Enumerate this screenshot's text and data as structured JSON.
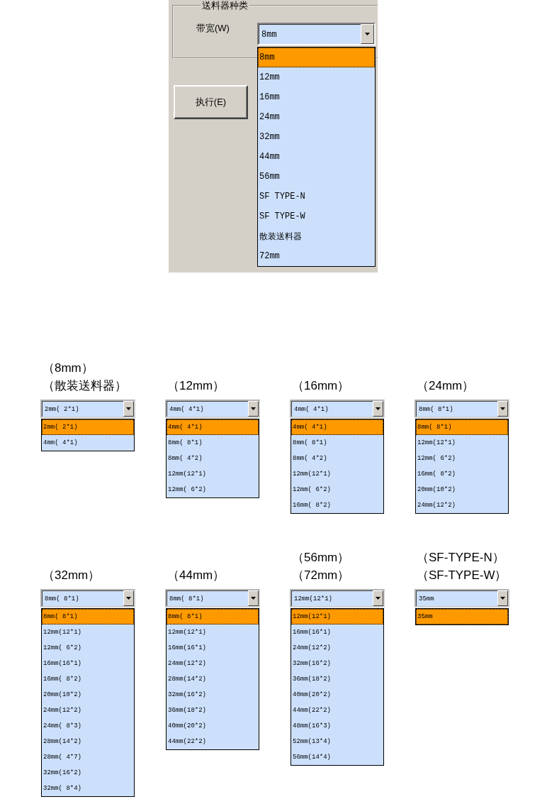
{
  "settings_panel": {
    "group_title": "送料器种类",
    "field_label": "带宽(W)",
    "combo": {
      "value": "8mm",
      "expanded": true,
      "options": [
        {
          "label": "8mm",
          "selected": true
        },
        {
          "label": "12mm",
          "selected": false
        },
        {
          "label": "16mm",
          "selected": false
        },
        {
          "label": "24mm",
          "selected": false
        },
        {
          "label": "32mm",
          "selected": false
        },
        {
          "label": "44mm",
          "selected": false
        },
        {
          "label": "56mm",
          "selected": false
        },
        {
          "label": "SF TYPE-N",
          "selected": false
        },
        {
          "label": "SF TYPE-W",
          "selected": false
        },
        {
          "label": "散装送料器",
          "selected": false
        },
        {
          "label": "72mm",
          "selected": false
        }
      ]
    },
    "execute_button": "执行(E)"
  },
  "examples": [
    {
      "captions": [
        "（8mm）",
        "（散装送料器）"
      ],
      "combo": {
        "value": "2mm( 2*1)",
        "expanded": true,
        "options": [
          {
            "label": "2mm( 2*1)",
            "selected": true
          },
          {
            "label": "4mm( 4*1)",
            "selected": false
          }
        ]
      }
    },
    {
      "captions": [
        "（12mm）"
      ],
      "combo": {
        "value": "4mm( 4*1)",
        "expanded": true,
        "options": [
          {
            "label": "4mm( 4*1)",
            "selected": true
          },
          {
            "label": "8mm( 8*1)",
            "selected": false
          },
          {
            "label": "8mm( 4*2)",
            "selected": false
          },
          {
            "label": "12mm(12*1)",
            "selected": false
          },
          {
            "label": "12mm( 6*2)",
            "selected": false
          }
        ]
      }
    },
    {
      "captions": [
        "（16mm）"
      ],
      "combo": {
        "value": "4mm( 4*1)",
        "expanded": true,
        "options": [
          {
            "label": "4mm( 4*1)",
            "selected": true
          },
          {
            "label": "8mm( 8*1)",
            "selected": false
          },
          {
            "label": "8mm( 4*2)",
            "selected": false
          },
          {
            "label": "12mm(12*1)",
            "selected": false
          },
          {
            "label": "12mm( 6*2)",
            "selected": false
          },
          {
            "label": "16mm( 8*2)",
            "selected": false
          }
        ]
      }
    },
    {
      "captions": [
        "（24mm）"
      ],
      "combo": {
        "value": "8mm( 8*1)",
        "expanded": true,
        "options": [
          {
            "label": "8mm( 8*1)",
            "selected": true
          },
          {
            "label": "12mm(12*1)",
            "selected": false
          },
          {
            "label": "12mm( 6*2)",
            "selected": false
          },
          {
            "label": "16mm( 8*2)",
            "selected": false
          },
          {
            "label": "20mm(10*2)",
            "selected": false
          },
          {
            "label": "24mm(12*2)",
            "selected": false
          }
        ]
      }
    },
    {
      "captions": [
        "（32mm）"
      ],
      "combo": {
        "value": "8mm( 8*1)",
        "expanded": true,
        "options": [
          {
            "label": "8mm( 8*1)",
            "selected": true
          },
          {
            "label": "12mm(12*1)",
            "selected": false
          },
          {
            "label": "12mm( 6*2)",
            "selected": false
          },
          {
            "label": "16mm(16*1)",
            "selected": false
          },
          {
            "label": "16mm( 8*2)",
            "selected": false
          },
          {
            "label": "20mm(10*2)",
            "selected": false
          },
          {
            "label": "24mm(12*2)",
            "selected": false
          },
          {
            "label": "24mm( 8*3)",
            "selected": false
          },
          {
            "label": "28mm(14*2)",
            "selected": false
          },
          {
            "label": "28mm( 4*7)",
            "selected": false
          },
          {
            "label": "32mm(16*2)",
            "selected": false
          },
          {
            "label": "32mm( 8*4)",
            "selected": false
          }
        ]
      }
    },
    {
      "captions": [
        "（44mm）"
      ],
      "combo": {
        "value": "8mm( 8*1)",
        "expanded": true,
        "options": [
          {
            "label": "8mm( 8*1)",
            "selected": true
          },
          {
            "label": "12mm(12*1)",
            "selected": false
          },
          {
            "label": "16mm(16*1)",
            "selected": false
          },
          {
            "label": "24mm(12*2)",
            "selected": false
          },
          {
            "label": "28mm(14*2)",
            "selected": false
          },
          {
            "label": "32mm(16*2)",
            "selected": false
          },
          {
            "label": "36mm(18*2)",
            "selected": false
          },
          {
            "label": "40mm(20*2)",
            "selected": false
          },
          {
            "label": "44mm(22*2)",
            "selected": false
          }
        ]
      }
    },
    {
      "captions": [
        "（56mm）",
        "（72mm）"
      ],
      "combo": {
        "value": "12mm(12*1)",
        "expanded": true,
        "options": [
          {
            "label": "12mm(12*1)",
            "selected": true
          },
          {
            "label": "16mm(16*1)",
            "selected": false
          },
          {
            "label": "24mm(12*2)",
            "selected": false
          },
          {
            "label": "32mm(16*2)",
            "selected": false
          },
          {
            "label": "36mm(18*2)",
            "selected": false
          },
          {
            "label": "40mm(20*2)",
            "selected": false
          },
          {
            "label": "44mm(22*2)",
            "selected": false
          },
          {
            "label": "48mm(16*3)",
            "selected": false
          },
          {
            "label": "52mm(13*4)",
            "selected": false
          },
          {
            "label": "56mm(14*4)",
            "selected": false
          }
        ]
      }
    },
    {
      "captions": [
        "（SF-TYPE-N）",
        "（SF-TYPE-W）"
      ],
      "combo": {
        "value": "35mm",
        "expanded": true,
        "options": [
          {
            "label": "35mm",
            "selected": true
          }
        ]
      }
    }
  ]
}
